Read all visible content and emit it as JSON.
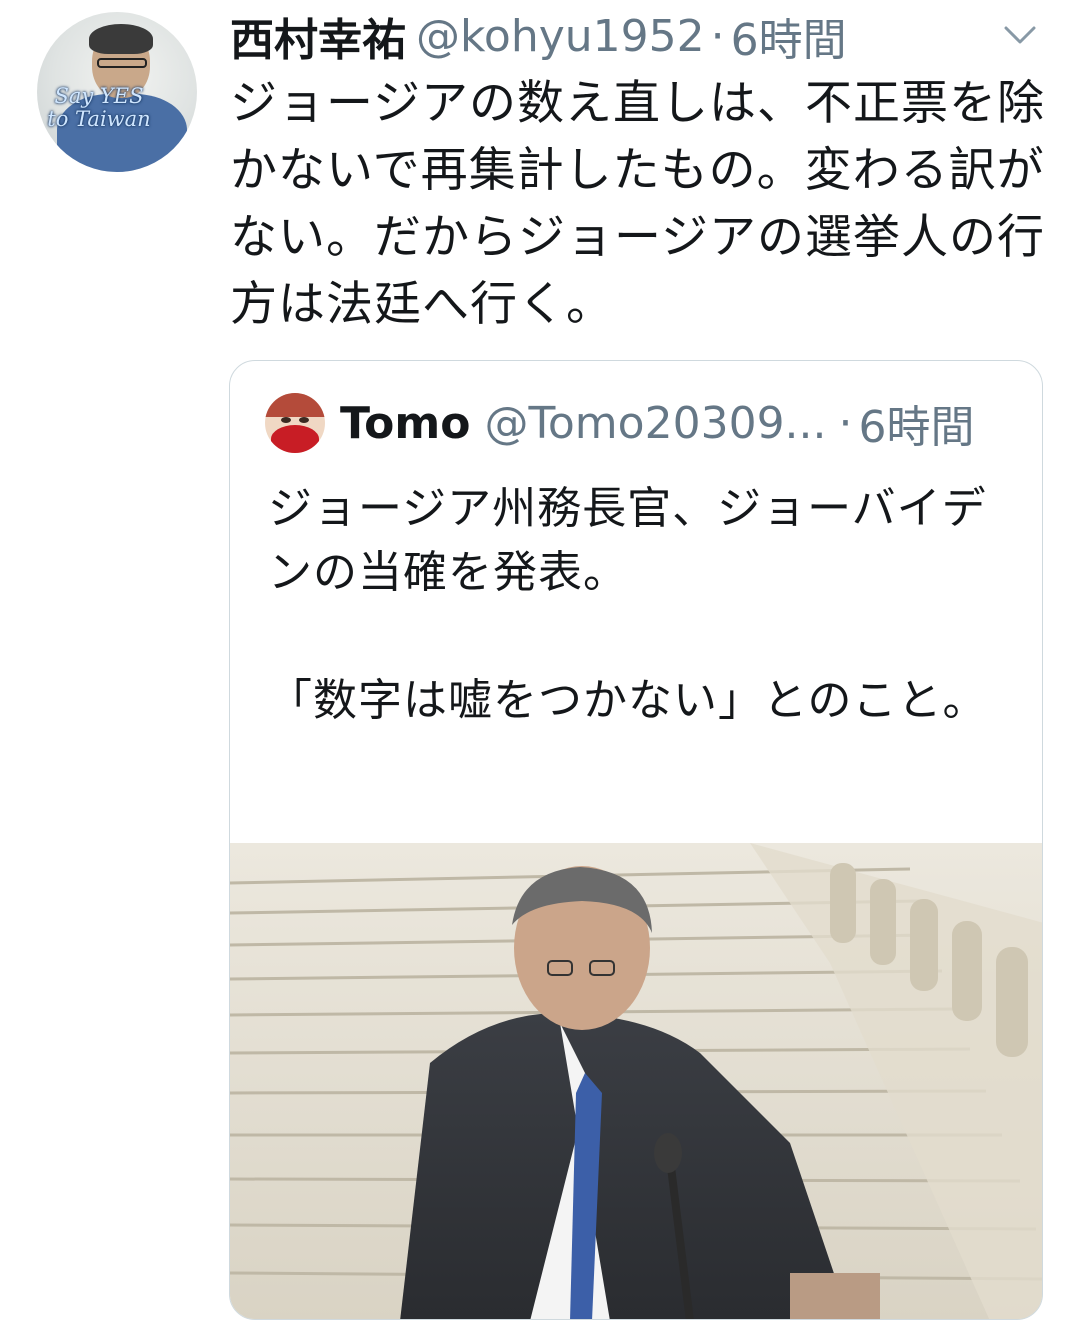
{
  "tweet": {
    "author_name": "西村幸祐",
    "author_handle": "@kohyu1952",
    "separator": "·",
    "time": "6時間",
    "avatar_caption_line1": "Say YES",
    "avatar_caption_line2": "to Taiwan",
    "text": "ジョージアの数え直しは、不正票を除かないで再集計したもの。変わる訳がない。だからジョージアの選挙人の行方は法廷へ行く。"
  },
  "quoted": {
    "author_name": "Tomo",
    "author_handle": "@Tomo20309...",
    "separator": "·",
    "time": "6時間",
    "text": "ジョージア州務長官、ジョーバイデンの当確を発表。\n\n「数字は嘘をつかない」とのこと。"
  },
  "icons": [
    "chevron-down-icon"
  ]
}
